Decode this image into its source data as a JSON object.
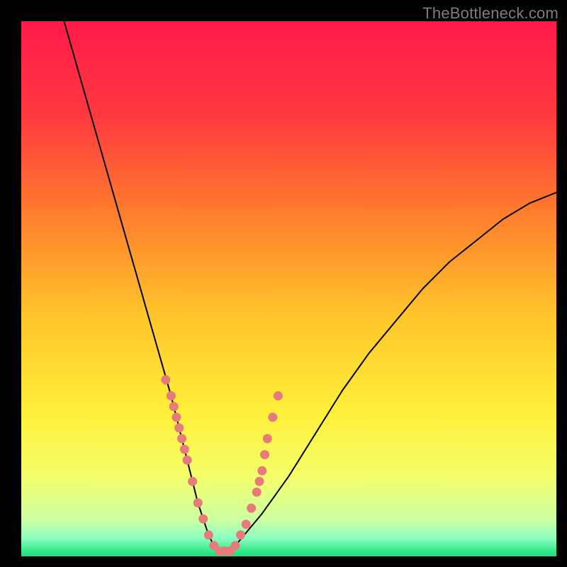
{
  "watermark": "TheBottleneck.com",
  "chart_data": {
    "type": "line",
    "title": "",
    "xlabel": "",
    "ylabel": "",
    "xlim": [
      0,
      100
    ],
    "ylim": [
      0,
      100
    ],
    "grid": false,
    "legend": false,
    "background_gradient": {
      "top_color": "#ff1a4b",
      "mid_colors": [
        "#ff6a2e",
        "#ffb42a",
        "#ffe52a",
        "#f8ff55",
        "#d8ff9a"
      ],
      "bottom_color": "#14e07a"
    },
    "series": [
      {
        "name": "bottleneck-curve",
        "stroke": "#000000",
        "x": [
          8,
          10,
          12,
          14,
          16,
          18,
          20,
          22,
          24,
          26,
          28,
          30,
          31,
          32,
          33,
          34,
          35,
          36,
          37,
          38,
          39,
          40,
          45,
          50,
          55,
          60,
          65,
          70,
          75,
          80,
          85,
          90,
          95,
          100
        ],
        "y": [
          100,
          93,
          86,
          79,
          72,
          65,
          58,
          51,
          44,
          37,
          30,
          22,
          18,
          14,
          10,
          7,
          4,
          2,
          1,
          1,
          1,
          2,
          8,
          15,
          23,
          31,
          38,
          44,
          50,
          55,
          59,
          63,
          66,
          68
        ]
      }
    ],
    "markers": {
      "name": "highlighted-points",
      "color": "#e77a7a",
      "x": [
        27,
        28,
        28.5,
        29,
        29.5,
        30,
        30.5,
        31,
        32,
        33,
        34,
        35,
        36,
        37,
        38,
        39,
        40,
        41,
        42,
        43,
        44,
        44.5,
        45,
        45.5,
        46,
        47,
        48
      ],
      "y": [
        33,
        30,
        28,
        26,
        24,
        22,
        20,
        18,
        14,
        10,
        7,
        4,
        2,
        1,
        1,
        1,
        2,
        4,
        6,
        9,
        12,
        14,
        16,
        19,
        22,
        26,
        30
      ]
    }
  }
}
